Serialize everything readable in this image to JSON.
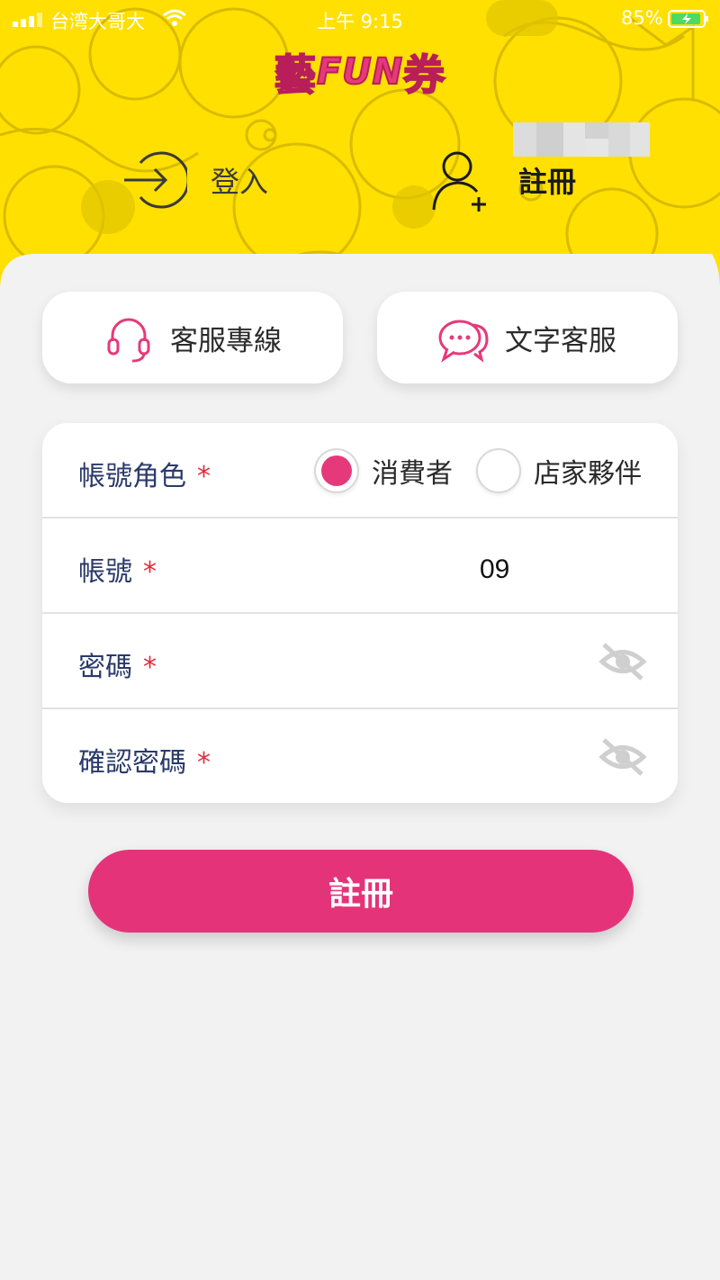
{
  "status_bar": {
    "carrier": "台湾大哥大",
    "time": "上午 9:15",
    "battery": "85%"
  },
  "app": {
    "logo_text_left": "藝",
    "logo_text_mid": "FUN",
    "logo_text_right": "券",
    "brand_color": "#e6397a",
    "header_color": "#ffe000"
  },
  "tabs": [
    {
      "label": "登入",
      "icon": "login-arrow-icon",
      "active": false
    },
    {
      "label": "註冊",
      "icon": "add-user-icon",
      "active": true
    }
  ],
  "support": {
    "phone_label": "客服專線",
    "chat_label": "文字客服"
  },
  "form": {
    "role": {
      "label": "帳號角色",
      "required_mark": "*",
      "options": [
        {
          "label": "消費者",
          "selected": true
        },
        {
          "label": "店家夥伴",
          "selected": false
        }
      ]
    },
    "account": {
      "label": "帳號",
      "required_mark": "*",
      "value": "09"
    },
    "password": {
      "label": "密碼",
      "required_mark": "*"
    },
    "confirm_password": {
      "label": "確認密碼",
      "required_mark": "*"
    }
  },
  "submit_label": "註冊"
}
